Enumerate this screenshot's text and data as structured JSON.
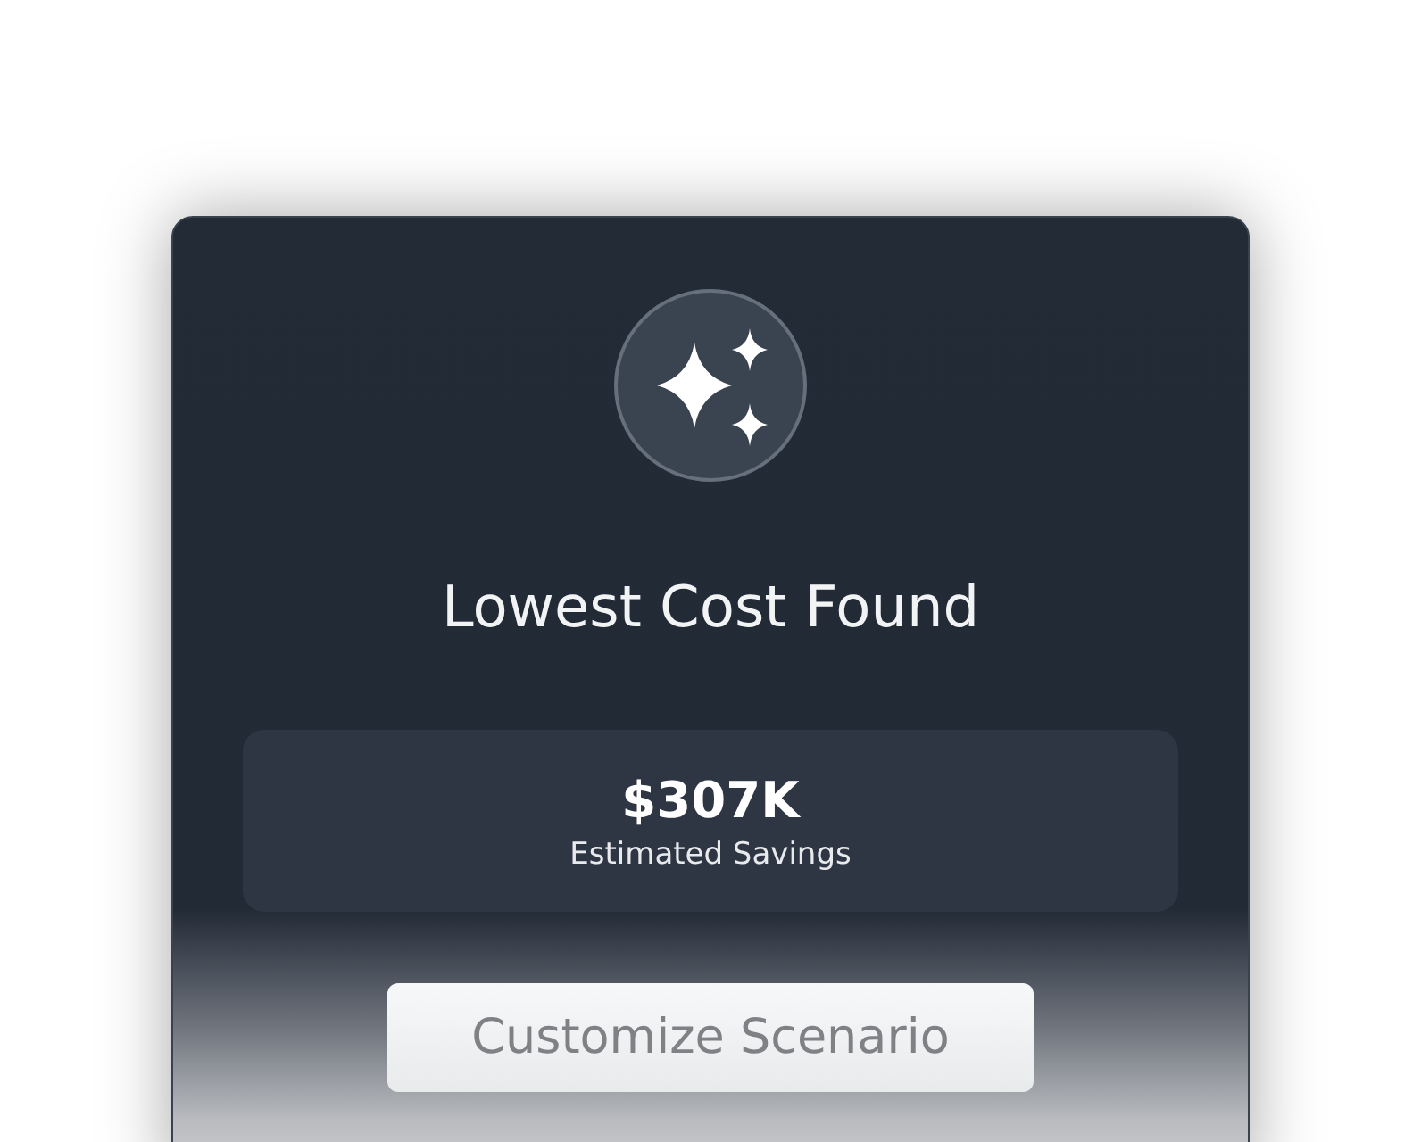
{
  "card": {
    "title": "Lowest Cost Found",
    "savings": {
      "amount": "$307K",
      "label": "Estimated Savings"
    },
    "button": {
      "label": "Customize Scenario"
    }
  }
}
